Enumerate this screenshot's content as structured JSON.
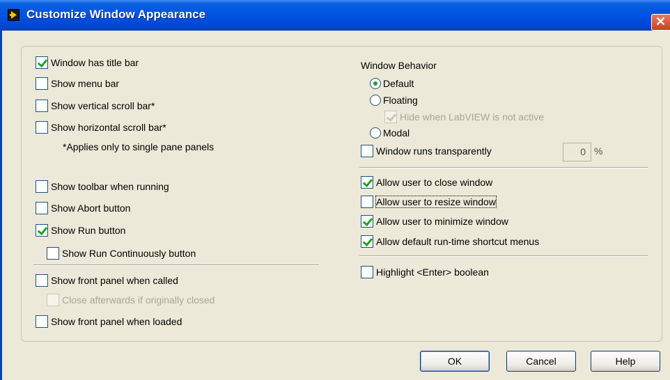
{
  "window": {
    "title": "Customize Window Appearance",
    "close_glyph": "✕",
    "icon": "labview-app-icon"
  },
  "left": {
    "title_bar": {
      "label": "Window has title bar",
      "checked": true
    },
    "menu_bar": {
      "label": "Show menu bar",
      "checked": false
    },
    "vscroll": {
      "label": "Show vertical scroll bar*",
      "checked": false
    },
    "hscroll": {
      "label": "Show horizontal scroll bar*",
      "checked": false
    },
    "note": "*Applies only to single pane panels",
    "toolbar": {
      "label": "Show toolbar when running",
      "checked": false
    },
    "abort": {
      "label": "Show Abort button",
      "checked": false
    },
    "run": {
      "label": "Show Run button",
      "checked": true
    },
    "run_cont": {
      "label": "Show Run Continuously button",
      "checked": false
    },
    "fp_called": {
      "label": "Show front panel when called",
      "checked": false
    },
    "close_after": {
      "label": "Close afterwards if originally closed",
      "checked": false,
      "disabled": true
    },
    "fp_loaded": {
      "label": "Show front panel when loaded",
      "checked": false
    }
  },
  "right": {
    "behavior_title": "Window Behavior",
    "default": {
      "label": "Default",
      "selected": true
    },
    "floating": {
      "label": "Floating",
      "selected": false
    },
    "hide_inactive": {
      "label": "Hide when LabVIEW is not active",
      "checked": true,
      "disabled": true
    },
    "modal": {
      "label": "Modal",
      "selected": false
    },
    "transparent": {
      "label": "Window runs transparently",
      "checked": false
    },
    "transparency_value": "0",
    "transparency_unit": "%",
    "allow_close": {
      "label": "Allow user to close window",
      "checked": true
    },
    "allow_resize": {
      "label": "Allow user to resize window",
      "checked": false
    },
    "allow_minimize": {
      "label": "Allow user to minimize window",
      "checked": true
    },
    "allow_shortcut": {
      "label": "Allow default run-time shortcut menus",
      "checked": true
    },
    "highlight_enter": {
      "label": "Highlight <Enter> boolean",
      "checked": false
    }
  },
  "buttons": {
    "ok": "OK",
    "cancel": "Cancel",
    "help": "Help"
  },
  "colors": {
    "titlebar": "#0054e3",
    "face": "#ece9d8",
    "check": "#21a121",
    "close": "#c9421f"
  }
}
